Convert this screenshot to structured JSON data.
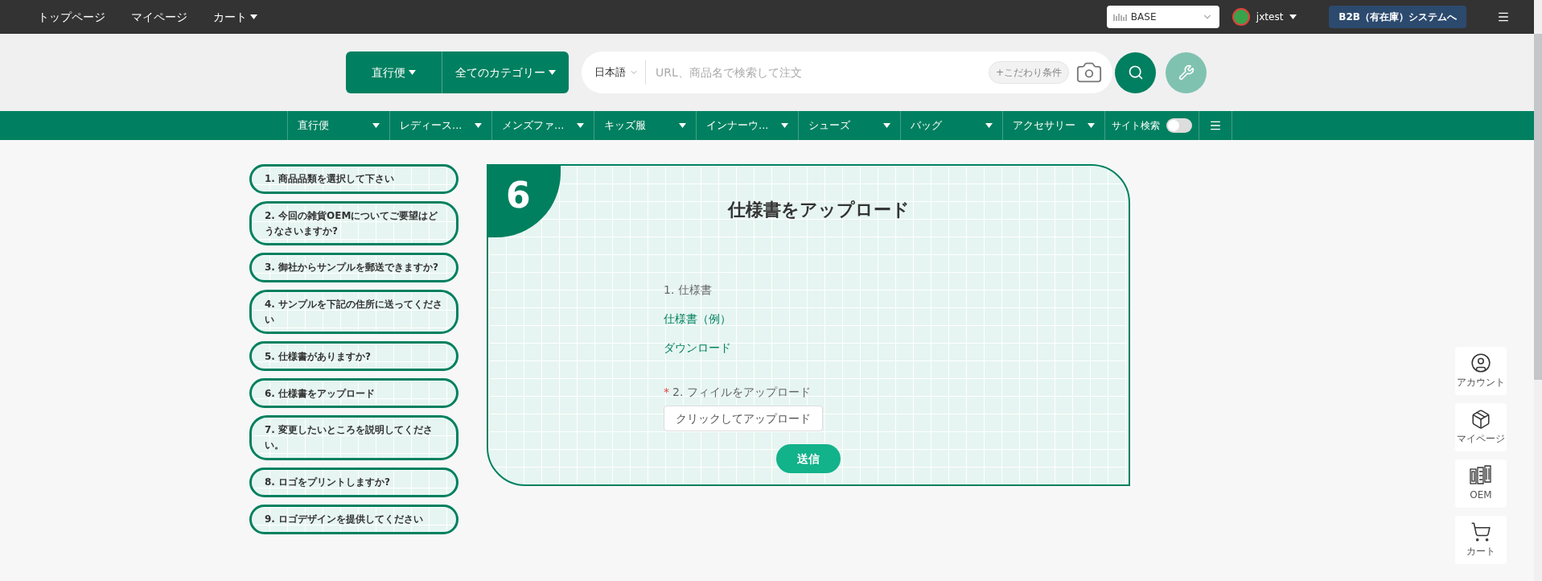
{
  "top_bar": {
    "links": [
      {
        "label": "トップページ",
        "caret": false
      },
      {
        "label": "マイページ",
        "caret": false
      },
      {
        "label": "カート",
        "caret": true
      }
    ],
    "store_select": {
      "value": "BASE"
    },
    "user": {
      "name": "jxtest"
    },
    "b2b_button": "B2B（有在庫）システムへ"
  },
  "search": {
    "mode_button": "直行便",
    "category_button": "全てのカテゴリー",
    "language": "日本語",
    "placeholder": "URL、商品名で検索して注文",
    "filter_chip": "+こだわり条件"
  },
  "nav": {
    "items": [
      "直行便",
      "レディース...",
      "メンズファ...",
      "キッズ服",
      "インナーウ...",
      "シューズ",
      "バッグ",
      "アクセサリー"
    ],
    "site_search": {
      "label": "サイト検索",
      "on": false
    }
  },
  "steps": [
    {
      "label": "1. 商品品類を選択して下さい"
    },
    {
      "label": "2. 今回の雑貨OEMについてご要望はどうなさいますか?"
    },
    {
      "label": "3. 御社からサンプルを郵送できますか?"
    },
    {
      "label": "4. サンプルを下記の住所に送ってください"
    },
    {
      "label": "5. 仕様書がありますか?"
    },
    {
      "label": "6. 仕様書をアップロード"
    },
    {
      "label": "7. 変更したいところを説明してください。"
    },
    {
      "label": "8. ロゴをプリントしますか?"
    },
    {
      "label": "9. ロゴデザインを提供してください"
    }
  ],
  "card": {
    "step_number": "6",
    "title": "仕様書をアップロード",
    "spec_label": "1. 仕様書",
    "example_link": "仕様書（例）",
    "download_link": "ダウンロード",
    "required_mark": "*",
    "upload_label": "2. フィイルをアップロード",
    "upload_button": "クリックしてアップロード",
    "submit_button": "送信"
  },
  "side_buttons": [
    {
      "kind": "account",
      "label": "アカウント"
    },
    {
      "kind": "mypage",
      "label": "マイページ"
    },
    {
      "kind": "oem",
      "label": "OEM"
    },
    {
      "kind": "cart",
      "label": "カート"
    }
  ]
}
